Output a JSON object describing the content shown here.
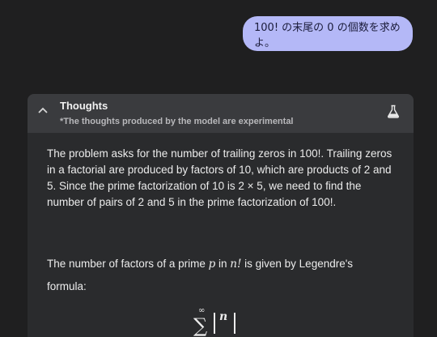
{
  "user_message": "100! の末尾の 0 の個数を求めよ。",
  "thoughts": {
    "title": "Thoughts",
    "subtitle": "*The thoughts produced by the model are experimental",
    "paragraph1": "The problem asks for the number of trailing zeros in 100!. Trailing zeros in a factorial are produced by factors of 10, which are products of 2 and 5. Since the prime factorization of 10 is 2 × 5, we need to find the number of pairs of 2 and 5 in the prime factorization of 100!.",
    "paragraph2_a": "The number of factors of a prime ",
    "paragraph2_p": "p",
    "paragraph2_b": " in ",
    "paragraph2_n": "n!",
    "paragraph2_c": " is given by Legendre's formula:",
    "formula_sup": "∞",
    "formula_sigma": "∑",
    "formula_n": "n"
  },
  "colors": {
    "background": "#1f1f20",
    "user_bubble": "#b4b8f7",
    "panel_header": "#3a3b3e",
    "panel_body": "#2a2b2d"
  },
  "icons": {
    "collapse": "chevron-up-icon",
    "experimental": "flask-icon"
  }
}
